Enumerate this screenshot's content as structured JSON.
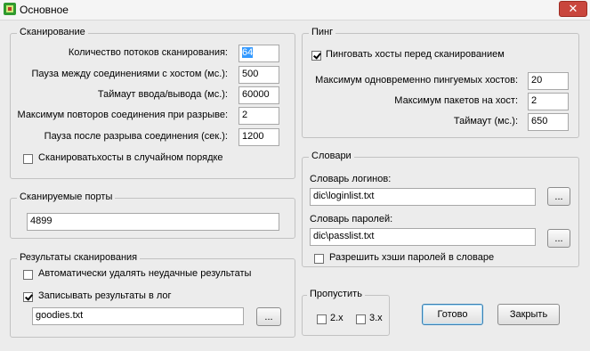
{
  "window": {
    "title": "Основное",
    "close_symbol": "✕"
  },
  "scan": {
    "legend": "Сканирование",
    "threads_label": "Количество потоков сканирования:",
    "threads_value": "64",
    "pause_label": "Пауза между соединениями с хостом (мс.):",
    "pause_value": "500",
    "timeout_label": "Таймаут ввода/вывода (мс.):",
    "timeout_value": "60000",
    "retries_label": "Максимум повторов соединения при разрыве:",
    "retries_value": "2",
    "pause_after_label": "Пауза после разрыва соединения (сек.):",
    "pause_after_value": "1200",
    "random_order_label": "Сканироватьхосты в случайном порядке",
    "random_order_checked": false
  },
  "ports": {
    "legend": "Сканируемые порты",
    "value": "4899"
  },
  "results": {
    "legend": "Результаты сканирования",
    "auto_delete_label": "Автоматически удалять неудачные результаты",
    "auto_delete_checked": false,
    "log_label": "Записывать результаты в лог",
    "log_checked": true,
    "log_file": "goodies.txt",
    "browse_label": "..."
  },
  "ping": {
    "legend": "Пинг",
    "ping_hosts_label": "Пинговать хосты перед сканированием",
    "ping_hosts_checked": true,
    "max_hosts_label": "Максимум одновременно пингуемых хостов:",
    "max_hosts_value": "20",
    "max_packets_label": "Максимум пакетов на хост:",
    "max_packets_value": "2",
    "timeout_label": "Таймаут (мс.):",
    "timeout_value": "650"
  },
  "dicts": {
    "legend": "Словари",
    "logins_label": "Словарь логинов:",
    "logins_value": "dic\\loginlist.txt",
    "passwords_label": "Словарь паролей:",
    "passwords_value": "dic\\passlist.txt",
    "browse_label": "...",
    "allow_hash_label": "Разрешить хэши паролей в словаре",
    "allow_hash_checked": false
  },
  "skip": {
    "legend": "Пропустить",
    "opt1_label": "2.x",
    "opt1_checked": false,
    "opt2_label": "3.x",
    "opt2_checked": false
  },
  "buttons": {
    "ok_label": "Готово",
    "close_label": "Закрыть"
  }
}
